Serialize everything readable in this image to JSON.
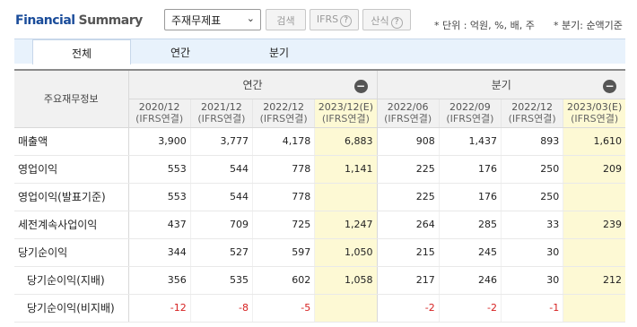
{
  "header": {
    "title_part1": "Financial",
    "title_part2": "Summary",
    "select_value": "주재무제표",
    "search_label": "검색",
    "ifrs_label": "IFRS",
    "formula_label": "산식",
    "help_glyph": "?",
    "unit_note": "* 단위 : 억원, %, 배, 주",
    "quarter_note": "* 분기: 순액기준"
  },
  "tabs": [
    {
      "label": "전체",
      "active": true
    },
    {
      "label": "연간",
      "active": false
    },
    {
      "label": "분기",
      "active": false
    }
  ],
  "table": {
    "row_header": "주요재무정보",
    "groups": [
      {
        "label": "연간",
        "collapse": "−"
      },
      {
        "label": "분기",
        "collapse": "−"
      }
    ],
    "periods": [
      {
        "date": "2020/12",
        "basis": "(IFRS연결)",
        "estimate": false
      },
      {
        "date": "2021/12",
        "basis": "(IFRS연결)",
        "estimate": false
      },
      {
        "date": "2022/12",
        "basis": "(IFRS연결)",
        "estimate": false
      },
      {
        "date": "2023/12(E)",
        "basis": "(IFRS연결)",
        "estimate": true
      },
      {
        "date": "2022/06",
        "basis": "(IFRS연결)",
        "estimate": false
      },
      {
        "date": "2022/09",
        "basis": "(IFRS연결)",
        "estimate": false
      },
      {
        "date": "2022/12",
        "basis": "(IFRS연결)",
        "estimate": false
      },
      {
        "date": "2023/03(E)",
        "basis": "(IFRS연결)",
        "estimate": true
      }
    ],
    "rows": [
      {
        "label": "매출액",
        "indent": false,
        "values": [
          "3,900",
          "3,777",
          "4,178",
          "6,883",
          "908",
          "1,437",
          "893",
          "1,610"
        ]
      },
      {
        "label": "영업이익",
        "indent": false,
        "values": [
          "553",
          "544",
          "778",
          "1,141",
          "225",
          "176",
          "250",
          "209"
        ]
      },
      {
        "label": "영업이익(발표기준)",
        "indent": false,
        "values": [
          "553",
          "544",
          "778",
          "",
          "225",
          "176",
          "250",
          ""
        ]
      },
      {
        "label": "세전계속사업이익",
        "indent": false,
        "values": [
          "437",
          "709",
          "725",
          "1,247",
          "264",
          "285",
          "33",
          "239"
        ]
      },
      {
        "label": "당기순이익",
        "indent": false,
        "values": [
          "344",
          "527",
          "597",
          "1,050",
          "215",
          "245",
          "30",
          ""
        ]
      },
      {
        "label": "당기순이익(지배)",
        "indent": true,
        "values": [
          "356",
          "535",
          "602",
          "1,058",
          "217",
          "246",
          "30",
          "212"
        ]
      },
      {
        "label": "당기순이익(비지배)",
        "indent": true,
        "values": [
          "-12",
          "-8",
          "-5",
          "",
          "-2",
          "-2",
          "-1",
          ""
        ]
      }
    ]
  },
  "colors": {
    "brand_blue": "#1a4c9a",
    "tab_bg": "#e8f2fc",
    "estimate_bg": "#fdf9d4",
    "negative": "#d62020"
  }
}
